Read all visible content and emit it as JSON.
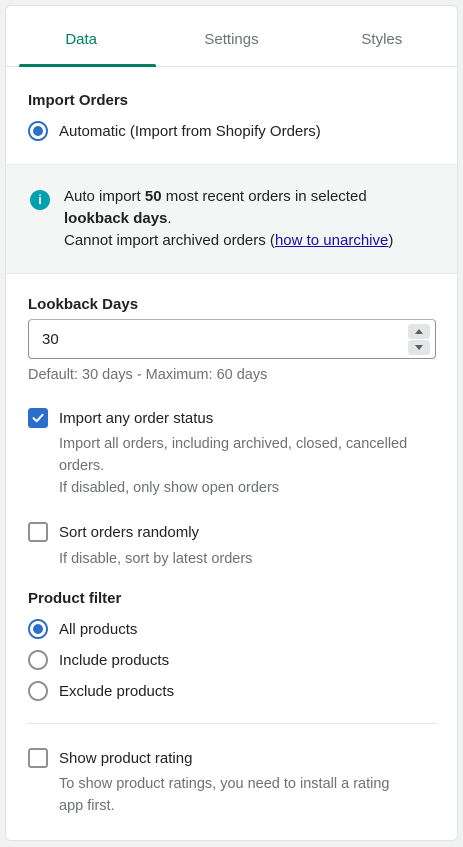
{
  "tabs": [
    {
      "label": "Data",
      "active": true
    },
    {
      "label": "Settings",
      "active": false
    },
    {
      "label": "Styles",
      "active": false
    }
  ],
  "import_orders": {
    "title": "Import Orders",
    "option_label": "Automatic (Import from Shopify Orders)",
    "selected": true
  },
  "info": {
    "line1_prefix": "Auto import ",
    "count": "50",
    "line1_suffix": " most recent orders in selected",
    "bold_phrase": "lookback days",
    "period": ".",
    "line3_prefix": "Cannot import archived orders (",
    "link_text": "how to unarchive",
    "line3_suffix": ")"
  },
  "lookback": {
    "title": "Lookback Days",
    "value": "30",
    "help": "Default: 30 days - Maximum: 60 days"
  },
  "import_any_status": {
    "label": "Import any order status",
    "checked": true,
    "help_line1": "Import all orders, including archived, closed, cancelled",
    "help_line2": "orders.",
    "help_line3": "If disabled, only show open orders"
  },
  "sort_random": {
    "label": "Sort orders randomly",
    "checked": false,
    "help": "If disable, sort by latest orders"
  },
  "product_filter": {
    "title": "Product filter",
    "options": [
      {
        "label": "All products",
        "selected": true
      },
      {
        "label": "Include products",
        "selected": false
      },
      {
        "label": "Exclude products",
        "selected": false
      }
    ]
  },
  "product_rating": {
    "label": "Show product rating",
    "checked": false,
    "help_line1": "To show product ratings, you need to install a rating",
    "help_line2": "app first."
  },
  "colors": {
    "accent_green": "#008060",
    "interactive_blue": "#2c6ecb",
    "info_teal": "#00a0ac"
  }
}
